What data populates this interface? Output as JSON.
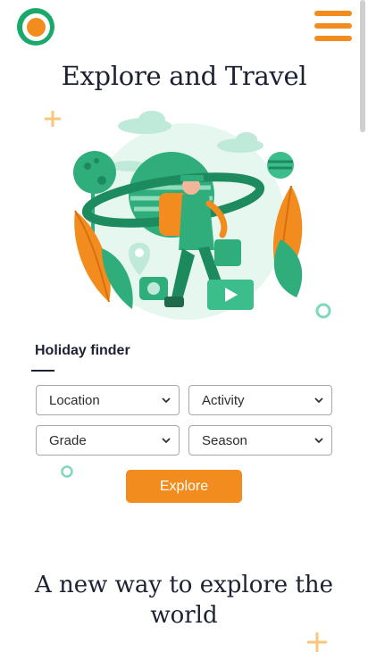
{
  "header": {
    "logo_icon": "logo-circle-icon",
    "menu_icon": "hamburger-menu-icon"
  },
  "hero": {
    "title": "Explore and Travel",
    "illustration": "traveler-with-planet-illustration"
  },
  "finder": {
    "title": "Holiday finder",
    "selects": {
      "location": "Location",
      "activity": "Activity",
      "grade": "Grade",
      "season": "Season"
    },
    "button_label": "Explore"
  },
  "section": {
    "title": "A new way to explore the world"
  },
  "colors": {
    "brand_green": "#1aa96b",
    "accent_orange": "#f28c1e",
    "text_dark": "#1d2233"
  }
}
